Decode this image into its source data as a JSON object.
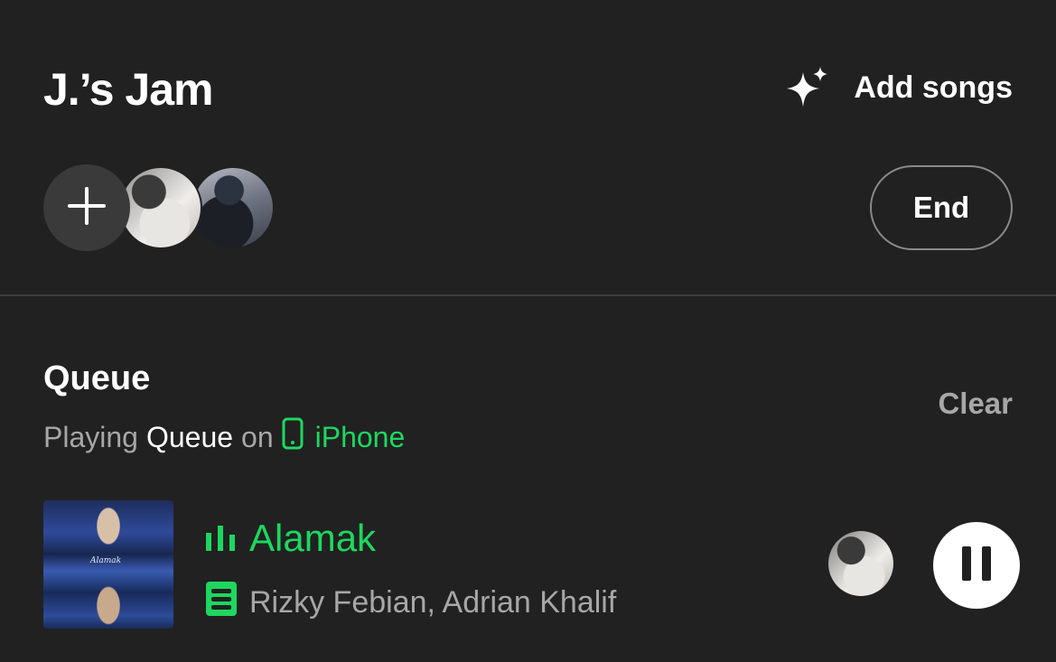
{
  "header": {
    "title": "J.’s Jam",
    "add_songs_label": "Add songs",
    "end_label": "End"
  },
  "participants": {
    "add_icon": "plus-icon",
    "avatars": [
      "participant-avatar-1",
      "participant-avatar-2"
    ]
  },
  "queue": {
    "title": "Queue",
    "clear_label": "Clear",
    "playing_prefix": "Playing",
    "playing_source": "Queue",
    "playing_on": "on",
    "device_name": "iPhone",
    "device_icon": "phone-icon"
  },
  "now_playing": {
    "title": "Alamak",
    "artists": "Rizky Febian, Adrian Khalif",
    "album_art_text": "Alamak",
    "equalizer_icon": "equalizer-icon",
    "jam_badge_icon": "jam-badge-icon",
    "control_icon": "pause-icon"
  },
  "colors": {
    "background": "#212121",
    "accent_green": "#1ed760",
    "secondary_text": "#a7a7a7"
  }
}
